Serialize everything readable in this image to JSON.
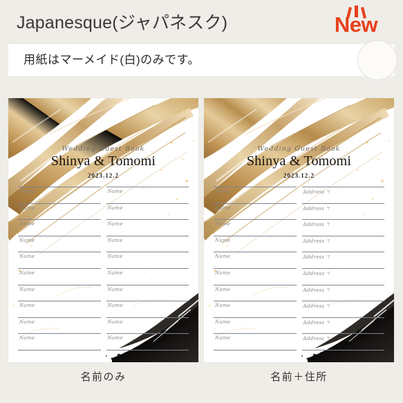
{
  "header": {
    "title": "Japanesque(ジャパネスク)",
    "badge": {
      "label": "New",
      "color": "#e8401c",
      "icon": "starburst-rays-icon"
    }
  },
  "notice": {
    "text": "用紙はマーメイド(白)のみです。",
    "circle_icon": "circle-decoration-icon",
    "background": "#ffffff"
  },
  "cards": [
    {
      "id": "name-only",
      "guestbook_label": "Wedding Guest Book",
      "couple_names": "Shinya & Tomomi",
      "event_date": "2023.12.2",
      "caption": "名前のみ",
      "columns": [
        "Name",
        "Name"
      ],
      "row_count": 10,
      "art": {
        "gold_brush": "#c59a5b",
        "ink_brush": "#14110f",
        "speckle": "#f0b95e"
      }
    },
    {
      "id": "name-plus-address",
      "guestbook_label": "Wedding Guest Book",
      "couple_names": "Shinya & Tomomi",
      "event_date": "2023.12.2",
      "caption": "名前＋住所",
      "columns": [
        "Name",
        "Address"
      ],
      "postal_mark": "〒",
      "row_count": 10,
      "art": {
        "gold_brush": "#c59a5b",
        "ink_brush": "#14110f",
        "speckle": "#f0b95e"
      }
    }
  ],
  "colors": {
    "page_background": "#efede8",
    "card_background": "#ffffff",
    "rule_line": "#7d8390",
    "title_text": "#3b3734",
    "accent": "#e8401c"
  }
}
